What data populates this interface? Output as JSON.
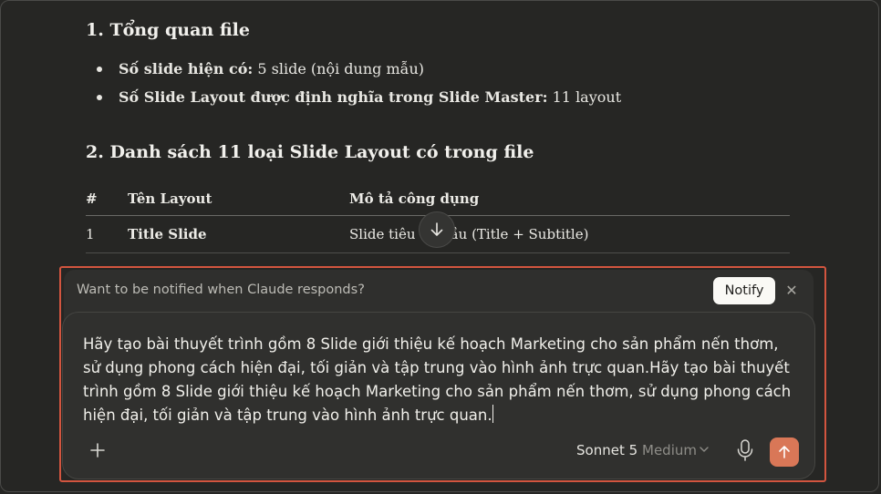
{
  "document": {
    "section1_title": "1. Tổng quan file",
    "bullets": [
      {
        "label": "Số slide hiện có:",
        "value": " 5 slide (nội dung mẫu)"
      },
      {
        "label": "Số Slide Layout được định nghĩa trong Slide Master:",
        "value": " 11 layout"
      }
    ],
    "section2_title": "2. Danh sách 11 loại Slide Layout có trong file",
    "table": {
      "headers": [
        "#",
        "Tên Layout",
        "Mô tả công dụng"
      ],
      "rows": [
        [
          "1",
          "Title Slide",
          "Slide tiêu đề đầu (Title + Subtitle)"
        ]
      ]
    }
  },
  "notify": {
    "message": "Want to be notified when Claude responds?",
    "button_label": "Notify",
    "close_glyph": "✕"
  },
  "composer": {
    "text": "Hãy tạo bài thuyết trình gồm 8 Slide giới thiệu kế hoạch Marketing cho sản phẩm nến thơm, sử dụng phong cách hiện đại, tối giản và tập trung vào hình ảnh trực quan.Hãy tạo bài thuyết trình gồm 8 Slide giới thiệu kế hoạch Marketing cho sản phẩm nến thơm, sử dụng phong cách hiện đại, tối giản và tập trung vào hình ảnh trực quan.",
    "model": "Sonnet 5",
    "effort": "Medium"
  },
  "colors": {
    "background": "#262624",
    "highlight_border": "#d2553f",
    "send_button": "#d97757"
  },
  "icons": [
    "arrow-down-icon",
    "close-icon",
    "plus-icon",
    "chevron-down-icon",
    "microphone-icon",
    "arrow-up-icon"
  ]
}
